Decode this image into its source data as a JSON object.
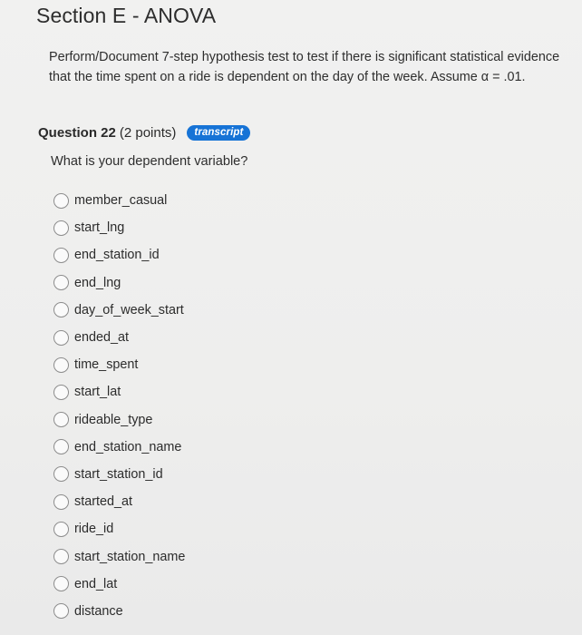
{
  "section": {
    "title": "Section E - ANOVA"
  },
  "instructions": "Perform/Document 7-step hypothesis test to test if there is significant statistical evidence that the time spent on a ride is dependent on the day of the week. Assume α = .01.",
  "question": {
    "number_label": "Question 22",
    "points_label": "(2 points)",
    "transcript_label": "transcript",
    "text": "What is your dependent variable?",
    "options": [
      {
        "label": "member_casual"
      },
      {
        "label": "start_lng"
      },
      {
        "label": "end_station_id"
      },
      {
        "label": "end_lng"
      },
      {
        "label": "day_of_week_start"
      },
      {
        "label": "ended_at"
      },
      {
        "label": "time_spent"
      },
      {
        "label": "start_lat"
      },
      {
        "label": "rideable_type"
      },
      {
        "label": "end_station_name"
      },
      {
        "label": "start_station_id"
      },
      {
        "label": "started_at"
      },
      {
        "label": "ride_id"
      },
      {
        "label": "start_station_name"
      },
      {
        "label": "end_lat"
      },
      {
        "label": "distance"
      }
    ]
  },
  "colors": {
    "background": "#efefee",
    "text": "#2b2b2b",
    "badge": "#1673d6",
    "radio_border": "#8c8c8c"
  }
}
